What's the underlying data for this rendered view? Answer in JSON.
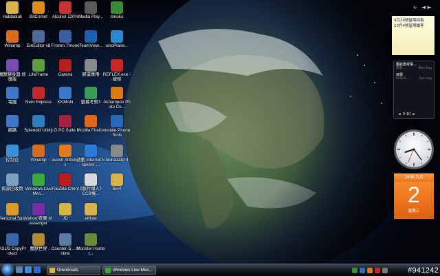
{
  "desktop_icons": [
    {
      "label": "Habbakuk",
      "col": 0,
      "row": 0,
      "icon": "folder-icon",
      "color": "#d9b24a"
    },
    {
      "label": "Winamp",
      "col": 0,
      "row": 1,
      "icon": "winamp-icon",
      "color": "#d86b1c"
    },
    {
      "label": "魔獸變身器 修復版",
      "col": 0,
      "row": 2,
      "icon": "app-icon",
      "color": "#7a4bb3"
    },
    {
      "label": "電腦",
      "col": 0,
      "row": 3,
      "icon": "computer-icon",
      "color": "#3f78c7"
    },
    {
      "label": "網路",
      "col": 0,
      "row": 4,
      "icon": "network-icon",
      "color": "#3f78c7"
    },
    {
      "label": "控制台",
      "col": 0,
      "row": 5,
      "icon": "control-panel-icon",
      "color": "#3d8ed8"
    },
    {
      "label": "資源回收筒",
      "col": 0,
      "row": 6,
      "icon": "recycle-bin-icon",
      "color": "#7d9fbf"
    },
    {
      "label": "Personal Safe",
      "col": 0,
      "row": 7,
      "icon": "safe-icon",
      "color": "#d99a2a"
    },
    {
      "label": "ASUS CopyProtect",
      "col": 0,
      "row": 8,
      "icon": "shield-icon",
      "color": "#3a66a8"
    },
    {
      "label": "BitComet",
      "col": 1,
      "row": 0,
      "icon": "bitcomet-icon",
      "color": "#e08a1e"
    },
    {
      "label": "EmEditor v8",
      "col": 1,
      "row": 1,
      "icon": "editor-icon",
      "color": "#4c6a9c"
    },
    {
      "label": "LifeFrame",
      "col": 1,
      "row": 2,
      "icon": "camera-icon",
      "color": "#5a9f3c"
    },
    {
      "label": "Nero Express",
      "col": 1,
      "row": 3,
      "icon": "disc-icon",
      "color": "#c42828"
    },
    {
      "label": "Splendid Utility",
      "col": 1,
      "row": 4,
      "icon": "monitor-icon",
      "color": "#2e7fc0"
    },
    {
      "label": "Winamp",
      "col": 1,
      "row": 5,
      "icon": "winamp-icon",
      "color": "#d86b1c"
    },
    {
      "label": "Windows Live Mes...",
      "col": 1,
      "row": 6,
      "icon": "messenger-icon",
      "color": "#3aa83a"
    },
    {
      "label": "Yahoo!奇摩 Messenger",
      "col": 1,
      "row": 7,
      "icon": "yahoo-icon",
      "color": "#7b2aa8"
    },
    {
      "label": "魔獸世界",
      "col": 1,
      "row": 8,
      "icon": "wow-icon",
      "color": "#b58a2a"
    },
    {
      "label": "Alcohol 120%",
      "col": 2,
      "row": 0,
      "icon": "alcohol-icon",
      "color": "#c43232"
    },
    {
      "label": "Frozen Throne",
      "col": 2,
      "row": 1,
      "icon": "game-icon",
      "color": "#3a5fa0"
    },
    {
      "label": "Garena",
      "col": 2,
      "row": 2,
      "icon": "garena-icon",
      "color": "#b82020"
    },
    {
      "label": "KKMAN",
      "col": 2,
      "row": 3,
      "icon": "browser-icon",
      "color": "#3a78c8"
    },
    {
      "label": "LG PC Suite II",
      "col": 2,
      "row": 4,
      "icon": "phone-icon",
      "color": "#a82040"
    },
    {
      "label": "avast! Antivirus",
      "col": 2,
      "row": 5,
      "icon": "avast-icon",
      "color": "#e07a1a"
    },
    {
      "label": "FileZilla Client",
      "col": 2,
      "row": 6,
      "icon": "filezilla-icon",
      "color": "#b81c1c"
    },
    {
      "label": "JD",
      "col": 2,
      "row": 7,
      "icon": "folder-icon",
      "color": "#d9b24a"
    },
    {
      "label": "Counter-S... Online",
      "col": 2,
      "row": 8,
      "icon": "game-icon",
      "color": "#5a7ca0"
    },
    {
      "label": "Media Play...",
      "col": 3,
      "row": 0,
      "icon": "media-player-icon",
      "color": "#5a5a5a"
    },
    {
      "label": "TeamView...",
      "col": 3,
      "row": 1,
      "icon": "teamviewer-icon",
      "color": "#1e5fb0"
    },
    {
      "label": "歸還專用",
      "col": 3,
      "row": 2,
      "icon": "app-icon",
      "color": "#8a8a8a"
    },
    {
      "label": "螢幕考勞3",
      "col": 3,
      "row": 3,
      "icon": "app-icon",
      "color": "#3a9a5a"
    },
    {
      "label": "Mozilla Firefox",
      "col": 3,
      "row": 4,
      "icon": "firefox-icon",
      "color": "#e0681a"
    },
    {
      "label": "啟動 Internet Explorer ...",
      "col": 3,
      "row": 5,
      "icon": "ie-icon",
      "color": "#2a7ad8"
    },
    {
      "label": "《龍吟傳入》CCB機...",
      "col": 3,
      "row": 6,
      "icon": "document-icon",
      "color": "#d8d8d8"
    },
    {
      "label": "eMule",
      "col": 3,
      "row": 7,
      "icon": "folder-icon",
      "color": "#d9b24a"
    },
    {
      "label": "Monster Hunter...",
      "col": 3,
      "row": 8,
      "icon": "game-icon",
      "color": "#6a8a3a"
    },
    {
      "label": "miroko",
      "col": 4,
      "row": 0,
      "icon": "miroko-icon",
      "color": "#3a8a3a"
    },
    {
      "label": "wiroPlane...",
      "col": 4,
      "row": 1,
      "icon": "plane-icon",
      "color": "#2a8ad0"
    },
    {
      "label": "REFLEX.exe - 捷徑",
      "col": 4,
      "row": 2,
      "icon": "reflex-icon",
      "color": "#c42828"
    },
    {
      "label": "Ashampoo Photo Co...",
      "col": 4,
      "row": 3,
      "icon": "photo-icon",
      "color": "#d87a1a"
    },
    {
      "label": "mobile PhoneTools",
      "col": 4,
      "row": 4,
      "icon": "phone-icon",
      "color": "#2a6ab8"
    },
    {
      "label": "biohazard 4",
      "col": 4,
      "row": 5,
      "icon": "game-icon",
      "color": "#8a8a8a"
    },
    {
      "label": "Bio4",
      "col": 4,
      "row": 6,
      "icon": "folder-icon",
      "color": "#d9b24a"
    }
  ],
  "sidebar": {
    "add_button": "+",
    "nav_buttons": "◄ ►",
    "notes": [
      "9月29號星期拍電",
      "10月4號星期讀客"
    ],
    "rss": {
      "items": [
        {
          "title": "藝航最常電...",
          "source": "雨港 - ...",
          "time": "Mon Aug"
        },
        {
          "title": "目標",
          "source": "RiVErS...",
          "time": "Sun Aug"
        }
      ],
      "pager": "9-10"
    },
    "clock": {
      "hour": 8,
      "minute": 24,
      "second": 34
    },
    "calendar": {
      "header": "2009 九月",
      "day": "2",
      "weekday": "星期三"
    }
  },
  "taskbar": {
    "tasks": [
      {
        "label": "Downloads",
        "icon": "folder-icon",
        "color": "#d9b24a"
      },
      {
        "label": "Windows Live Mes...",
        "icon": "messenger-icon",
        "color": "#3aa83a"
      }
    ],
    "tray_text": "#941242"
  }
}
